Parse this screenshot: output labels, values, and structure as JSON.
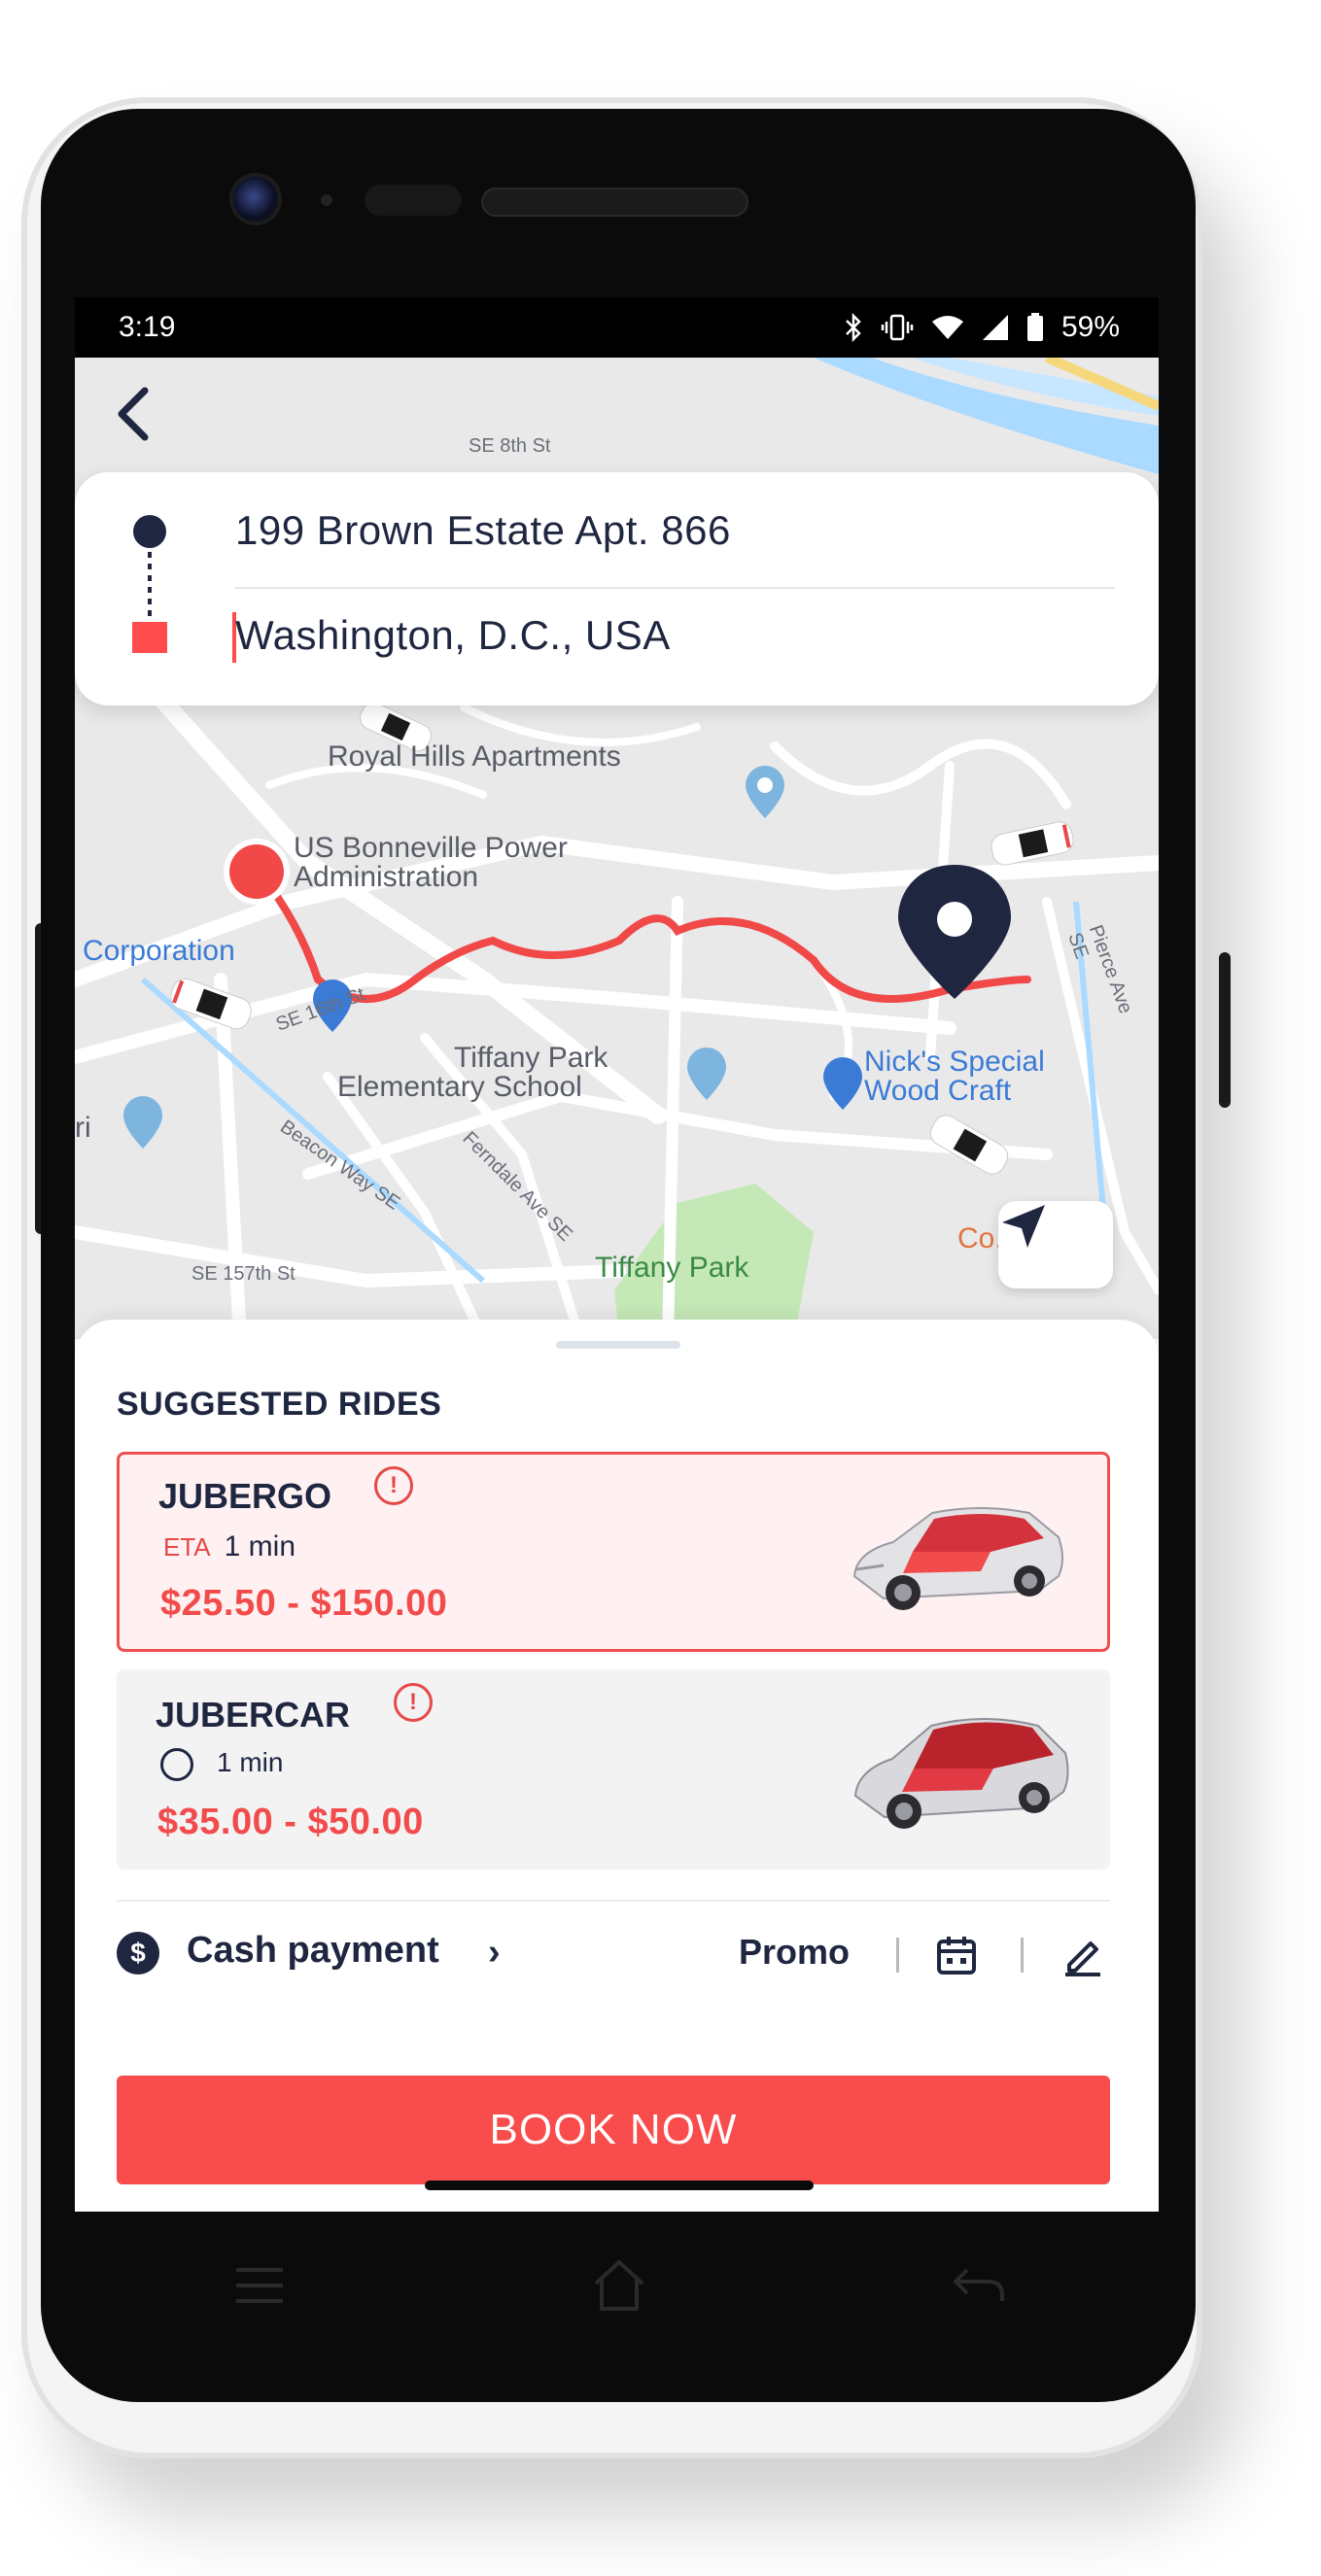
{
  "status_bar": {
    "time": "3:19",
    "battery": "59%"
  },
  "trip": {
    "from": "199 Brown Estate Apt. 866",
    "to": "Washington, D.C., USA"
  },
  "map": {
    "labels": {
      "se_8th": "SE 8th St",
      "royal_hills": "Royal Hills Apartments",
      "bonneville_1": "US Bonneville Power",
      "bonneville_2": "Administration",
      "corporation": "Corporation",
      "se_16th": "SE 16th St",
      "tiffany_school_1": "Tiffany Park",
      "tiffany_school_2": "Elementary School",
      "nicks_1": "Nick's Special",
      "nicks_2": "Wood Craft",
      "beacon": "Beacon Way SE",
      "ferndale": "Ferndale Ave SE",
      "pierce": "Pierce Ave SE",
      "se_157th": "SE 157th St",
      "tiffany_park": "Tiffany Park",
      "orange_label": "Co...By",
      "ri": "ri"
    }
  },
  "suggested": {
    "title": "SUGGESTED RIDES",
    "rides": [
      {
        "name": "JUBERGO",
        "eta_tag": "ETA",
        "eta": "1 min",
        "price": "$25.50 - $150.00",
        "selected": true
      },
      {
        "name": "JUBERCAR",
        "eta": "1 min",
        "price": "$35.00 - $50.00",
        "selected": false
      }
    ]
  },
  "payment": {
    "label": "Cash payment",
    "promo": "Promo",
    "currency_symbol": "$"
  },
  "actions": {
    "book": "BOOK NOW"
  },
  "colors": {
    "accent": "#f94c4c",
    "navy": "#1f2640",
    "map_bg": "#e9e9ea"
  }
}
